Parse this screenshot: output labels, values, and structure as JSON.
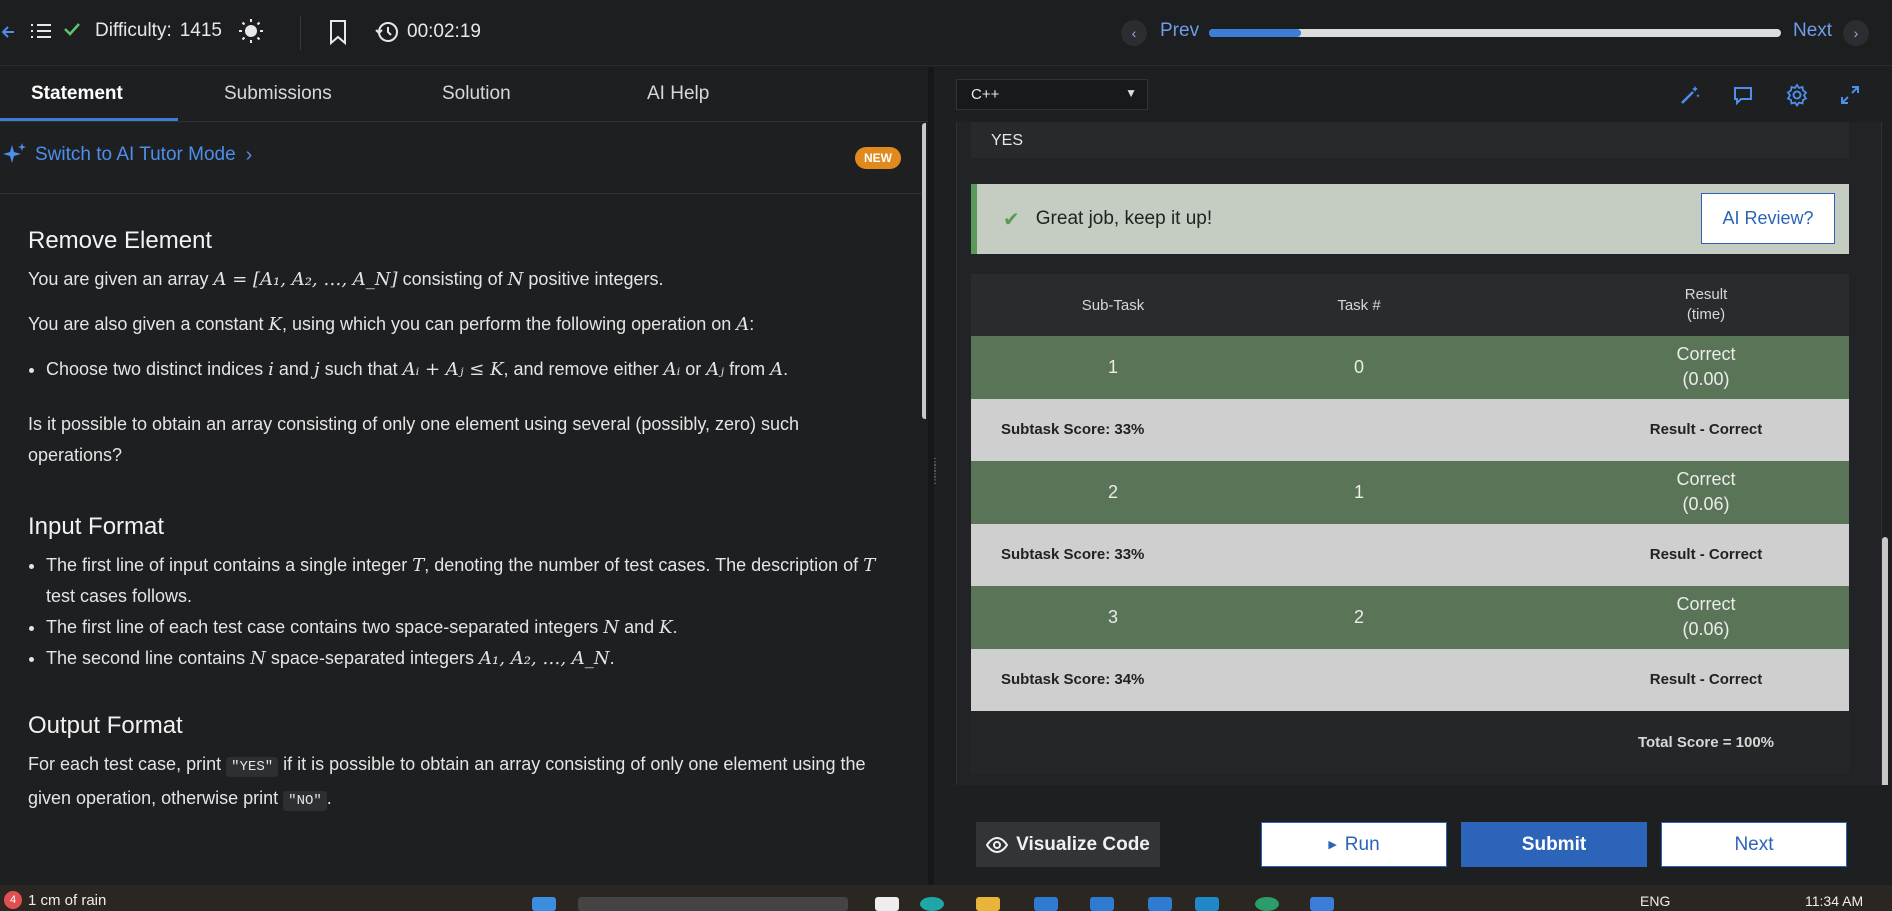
{
  "topbar": {
    "difficulty_label": "Difficulty:",
    "difficulty_value": "1415",
    "timer": "00:02:19",
    "prev_label": "Prev",
    "next_label": "Next",
    "progress": 0.16
  },
  "tabs": [
    "Statement",
    "Submissions",
    "Solution",
    "AI Help"
  ],
  "left": {
    "tutor_link": "Switch to AI Tutor Mode",
    "new_badge": "NEW",
    "problem_title": "Remove Element",
    "p1_a": "You are given an array",
    "p1_math": "A = [A₁, A₂, …, A_N]",
    "p1_b": "consisting of",
    "p1_n": "N",
    "p1_c": "positive integers.",
    "p2_a": "You are also given a constant",
    "p2_k": "K",
    "p2_b": ", using which you can perform the following operation on",
    "p2_A": "A",
    "p2_c": ":",
    "op_a": "Choose two distinct indices",
    "op_i": "i",
    "op_and": "and",
    "op_j": "j",
    "op_such": "such that",
    "op_cond": "Aᵢ + Aⱼ ≤ K",
    "op_remove": ", and remove either",
    "op_ai": "Aᵢ",
    "op_or": "or",
    "op_aj": "Aⱼ",
    "op_from": "from",
    "op_A": "A",
    "op_end": ".",
    "q": "Is it possible to obtain an array consisting of only one element using several (possibly, zero) such operations?",
    "input_title": "Input Format",
    "in1_a": "The first line of input contains a single integer",
    "in1_t": "T",
    "in1_b": ", denoting the number of test cases. The description of",
    "in1_t2": "T",
    "in1_c": "test cases follows.",
    "in2_a": "The first line of each test case contains two space-separated integers",
    "in2_n": "N",
    "in2_and": "and",
    "in2_k": "K",
    "in2_end": ".",
    "in3_a": "The second line contains",
    "in3_n": "N",
    "in3_b": "space-separated integers",
    "in3_math": "A₁, A₂, …, A_N",
    "in3_end": ".",
    "output_title": "Output Format",
    "out_a": "For each test case, print",
    "out_yes": "\"YES\"",
    "out_b": "if it is possible to obtain an array consisting of only one element using the given operation, otherwise print",
    "out_no": "\"NO\"",
    "out_end": "."
  },
  "right": {
    "language": "C++",
    "output_preview": "YES",
    "success_msg": "Great job, keep it up!",
    "ai_review": "AI Review?",
    "headers": {
      "subtask": "Sub-Task",
      "task": "Task #",
      "result_1": "Result",
      "result_2": "(time)"
    },
    "rows": [
      {
        "subtask": "1",
        "task": "0",
        "result": "Correct",
        "time": "(0.00)",
        "score": "Subtask Score: 33%",
        "score_result": "Result - Correct"
      },
      {
        "subtask": "2",
        "task": "1",
        "result": "Correct",
        "time": "(0.06)",
        "score": "Subtask Score: 33%",
        "score_result": "Result - Correct"
      },
      {
        "subtask": "3",
        "task": "2",
        "result": "Correct",
        "time": "(0.06)",
        "score": "Subtask Score: 34%",
        "score_result": "Result - Correct"
      }
    ],
    "total": "Total Score = 100%"
  },
  "actions": {
    "visualize": "Visualize Code",
    "run": "Run",
    "submit": "Submit",
    "next": "Next"
  },
  "taskbar": {
    "weather_badge": "4",
    "weather": "1 cm of rain",
    "lang": "ENG",
    "time": "11:34 AM"
  },
  "colors": {
    "accent": "#3b7dd8",
    "success_green": "#5a9a58",
    "row_green": "#5a7457",
    "badge_orange": "#e08a1e"
  }
}
